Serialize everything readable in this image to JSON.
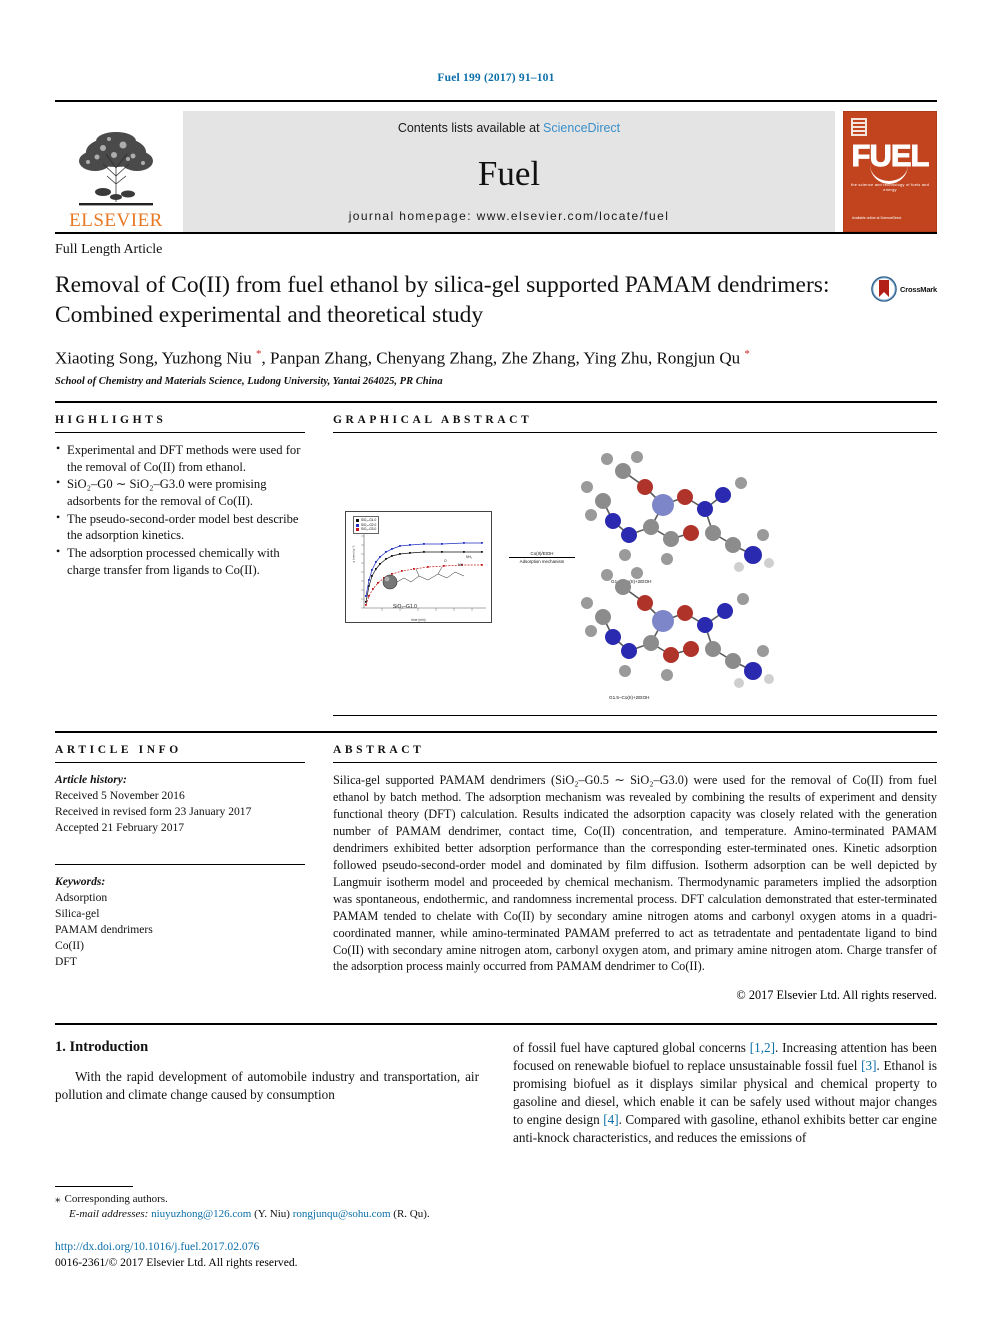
{
  "running_head": "Fuel 199 (2017) 91–101",
  "masthead": {
    "contents_prefix": "Contents lists available at ",
    "sciencedirect": "ScienceDirect",
    "journal_name": "Fuel",
    "homepage": "journal homepage: www.elsevier.com/locate/fuel",
    "publisher": "ELSEVIER",
    "cover": {
      "wordmark": "FUEL",
      "subtitle": "the science and technology of fuels and energy",
      "footer": "Available online at\nScienceDirect"
    }
  },
  "article": {
    "type": "Full Length Article",
    "title": "Removal of Co(II) from fuel ethanol by silica-gel supported PAMAM dendrimers: Combined experimental and theoretical study",
    "crossmark_label": "CrossMark",
    "authors_html": "Xiaoting Song, Yuzhong Niu <sup>*</sup>, Panpan Zhang, Chenyang Zhang, Zhe Zhang, Ying Zhu, Rongjun Qu <sup>*</sup>",
    "affiliation": "School of Chemistry and Materials Science, Ludong University, Yantai 264025, PR China"
  },
  "highlights": {
    "heading": "HIGHLIGHTS",
    "items": [
      "Experimental and DFT methods were used for the removal of Co(II) from ethanol.",
      "SiO₂–G0 ∼ SiO₂–G3.0 were promising adsorbents for the removal of Co(II).",
      "The pseudo-second-order model best describe the adsorption kinetics.",
      "The adsorption processed chemically with charge transfer from ligands to Co(II)."
    ]
  },
  "graphical_abstract": {
    "heading": "GRAPHICAL ABSTRACT",
    "scheme_label": "SiO₂–G1.0",
    "arrow_top": "Co(II)/EtOH",
    "arrow_bottom": "Adsorption mechanism",
    "mol_label_top": "G1.0–Co(II)+2EtOH",
    "mol_label_bottom": "G1.5–Co(II)+2EtOH",
    "chart": {
      "legend": [
        "SiO₂–G1.0",
        "SiO₂–G2.0",
        "SiO₂–G3.0"
      ],
      "xlabel": "time (min)",
      "ylabel": "q (mmol g⁻¹)"
    }
  },
  "article_info": {
    "heading": "ARTICLE INFO",
    "history_label": "Article history:",
    "history": [
      "Received 5 November 2016",
      "Received in revised form 23 January 2017",
      "Accepted 21 February 2017"
    ],
    "keywords_label": "Keywords:",
    "keywords": [
      "Adsorption",
      "Silica-gel",
      "PAMAM dendrimers",
      "Co(II)",
      "DFT"
    ]
  },
  "abstract": {
    "heading": "ABSTRACT",
    "text": "Silica-gel supported PAMAM dendrimers (SiO₂–G0.5 ∼ SiO₂–G3.0) were used for the removal of Co(II) from fuel ethanol by batch method. The adsorption mechanism was revealed by combining the results of experiment and density functional theory (DFT) calculation. Results indicated the adsorption capacity was closely related with the generation number of PAMAM dendrimer, contact time, Co(II) concentration, and temperature. Amino-terminated PAMAM dendrimers exhibited better adsorption performance than the corresponding ester-terminated ones. Kinetic adsorption followed pseudo-second-order model and dominated by film diffusion. Isotherm adsorption can be well depicted by Langmuir isotherm model and proceeded by chemical mechanism. Thermodynamic parameters implied the adsorption was spontaneous, endothermic, and randomness incremental process. DFT calculation demonstrated that ester-terminated PAMAM tended to chelate with Co(II) by secondary amine nitrogen atoms and carbonyl oxygen atoms in a quadri-coordinated manner, while amino-terminated PAMAM preferred to act as tetradentate and pentadentate ligand to bind Co(II) with secondary amine nitrogen atom, carbonyl oxygen atom, and primary amine nitrogen atom. Charge transfer of the adsorption process mainly occurred from PAMAM dendrimer to Co(II).",
    "copyright": "© 2017 Elsevier Ltd. All rights reserved."
  },
  "introduction": {
    "heading": "1. Introduction",
    "left_paragraph": "With the rapid development of automobile industry and transportation, air pollution and climate change caused by consumption",
    "right_paragraph_parts": [
      "of fossil fuel have captured global concerns ",
      "[1,2]",
      ". Increasing attention has been focused on renewable biofuel to replace unsustainable fossil fuel ",
      "[3]",
      ". Ethanol is promising biofuel as it displays similar physical and chemical property to gasoline and diesel, which enable it can be safely used without major changes to engine design ",
      "[4]",
      ". Compared with gasoline, ethanol exhibits better car engine anti-knock characteristics, and reduces the emissions of"
    ]
  },
  "footer": {
    "corresponding_star": "⁎",
    "corresponding_text": "Corresponding authors.",
    "email_label": "E-mail addresses:",
    "email1": "niuyuzhong@126.com",
    "email1_owner": "(Y. Niu)",
    "email2": "rongjunqu@sohu.com",
    "email2_owner": "(R. Qu).",
    "doi": "http://dx.doi.org/10.1016/j.fuel.2017.02.076",
    "issn_line": "0016-2361/© 2017 Elsevier Ltd. All rights reserved."
  },
  "colors": {
    "link_blue": "#0b6ea8",
    "sciencedirect_blue": "#3a8fcb",
    "elsevier_orange": "#e87722",
    "cover_orange": "#c1441e",
    "asterisk_red": "#cc1f1f"
  }
}
